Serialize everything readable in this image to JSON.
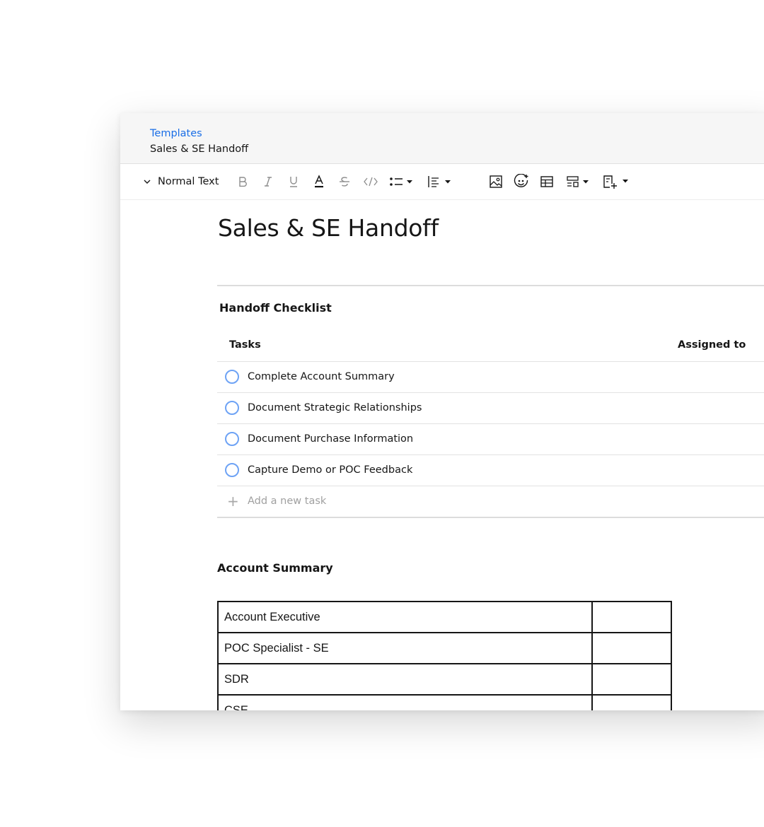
{
  "breadcrumb": {
    "link": "Templates",
    "current": "Sales & SE Handoff"
  },
  "toolbar": {
    "text_style": "Normal Text",
    "icons": [
      "chevron-down-icon",
      "bold-icon",
      "italic-icon",
      "underline-icon",
      "text-color-icon",
      "strikethrough-icon",
      "code-icon",
      "bullet-list-icon",
      "align-icon",
      "image-icon",
      "emoji-icon",
      "table-icon",
      "layout-icon",
      "template-icon"
    ]
  },
  "document": {
    "title": "Sales & SE Handoff"
  },
  "checklist": {
    "title": "Handoff Checklist",
    "columns": {
      "tasks": "Tasks",
      "assigned": "Assigned to"
    },
    "tasks": [
      "Complete Account Summary",
      "Document Strategic Relationships",
      "Document Purchase Information",
      "Capture Demo or POC Feedback"
    ],
    "add_placeholder": "Add a new task"
  },
  "account_summary": {
    "title": "Account Summary",
    "rows": [
      {
        "label": "Account Executive",
        "value": ""
      },
      {
        "label": "POC Specialist - SE",
        "value": ""
      },
      {
        "label": "SDR",
        "value": ""
      },
      {
        "label": "CSE",
        "value": ""
      }
    ]
  },
  "colors": {
    "link": "#1a6ee6",
    "task_circle": "#6ea3f5",
    "text": "#161616",
    "icon": "#6f6f6f"
  }
}
